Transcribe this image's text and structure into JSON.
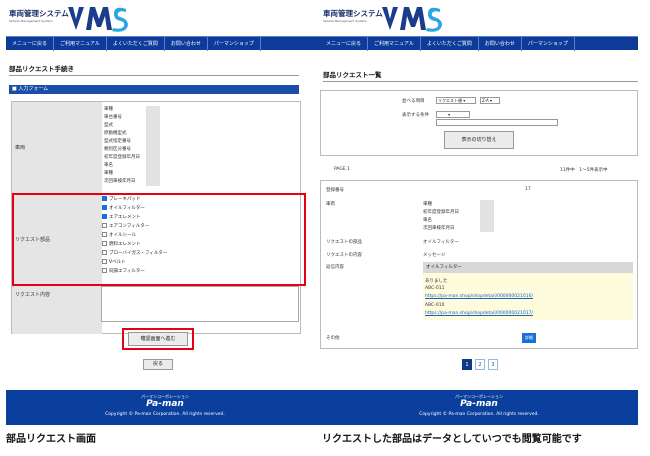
{
  "header": {
    "brand": "車両管理システム",
    "brand_sub": "Vehicle Management System",
    "logo": "VMS"
  },
  "nav": [
    "メニューに戻る",
    "ご利用マニュアル",
    "よくいただくご質問",
    "お問い合わせ",
    "パーマンショップ"
  ],
  "left": {
    "title": "部品リクエスト手続き",
    "section": "■ 入力フォーム",
    "vehicle_label": "車両",
    "vehicle_fields": [
      "車種",
      "車台番号",
      "型式",
      "原動機型式",
      "型式指定番号",
      "類別区分番号",
      "初年度登録年月日",
      "車名",
      "車種",
      "次回車検年月日"
    ],
    "request_label": "リクエスト部品",
    "parts": [
      {
        "name": "ブレーキパッド",
        "checked": true
      },
      {
        "name": "オイルフィルター",
        "checked": true
      },
      {
        "name": "エアエレメント",
        "checked": true
      },
      {
        "name": "エアコンフィルター",
        "checked": false
      },
      {
        "name": "オイルシール",
        "checked": false
      },
      {
        "name": "燃料エレメント",
        "checked": false
      },
      {
        "name": "ブローバイガス・フィルター",
        "checked": false
      },
      {
        "name": "Vベルト",
        "checked": false
      },
      {
        "name": "同調エフィルター",
        "checked": false
      }
    ],
    "content_label": "リクエスト内容",
    "confirm_btn": "確認画面へ進む",
    "back_btn": "戻る"
  },
  "right": {
    "title": "部品リクエスト一覧",
    "sort_label": "並べる項目",
    "sort_value": "リクエスト順",
    "sort_order": "Z-A",
    "cond_label": "表示する条件",
    "toggle_btn": "表示の切り替え",
    "page_label": "PAGE.1",
    "count_text": "11件中　1〜5件表示中",
    "reg_label": "登録番号",
    "reg_value": "17",
    "vehicle_label": "車両",
    "vehicle_fields": [
      "車種",
      "初年度登録年月日",
      "車名",
      "次回車検年月日"
    ],
    "part_label": "リクエストの部品",
    "part_value": "オイルフィルター",
    "content_label": "リクエストの内容",
    "content_value": "メッセージ",
    "reply_label": "返信内容",
    "reply_head": "オイルフィルター",
    "reply_lines": [
      "ありました",
      "ABC-011"
    ],
    "link1": "https://pa-man.shop/shopdetail/000000021016/",
    "reply_line3": "ABC-010",
    "link2": "https://pa-man.shop/shopdetail/000000021017/",
    "other_label": "その他",
    "detail_btn": "詳細",
    "pages": [
      "1",
      "2",
      "3"
    ]
  },
  "footer": {
    "sub": "パーマンコーポレーション",
    "logo": "Pa-man",
    "copy": "Copyright © Pa-man Corporation. All rights reserved."
  },
  "captions": {
    "left": "部品リクエスト画面",
    "right": "リクエストした部品はデータとしていつでも閲覧可能です"
  },
  "colors": {
    "nav": "#0e3b9a",
    "accent_red": "#e60012",
    "footer": "#0b3f9e"
  }
}
